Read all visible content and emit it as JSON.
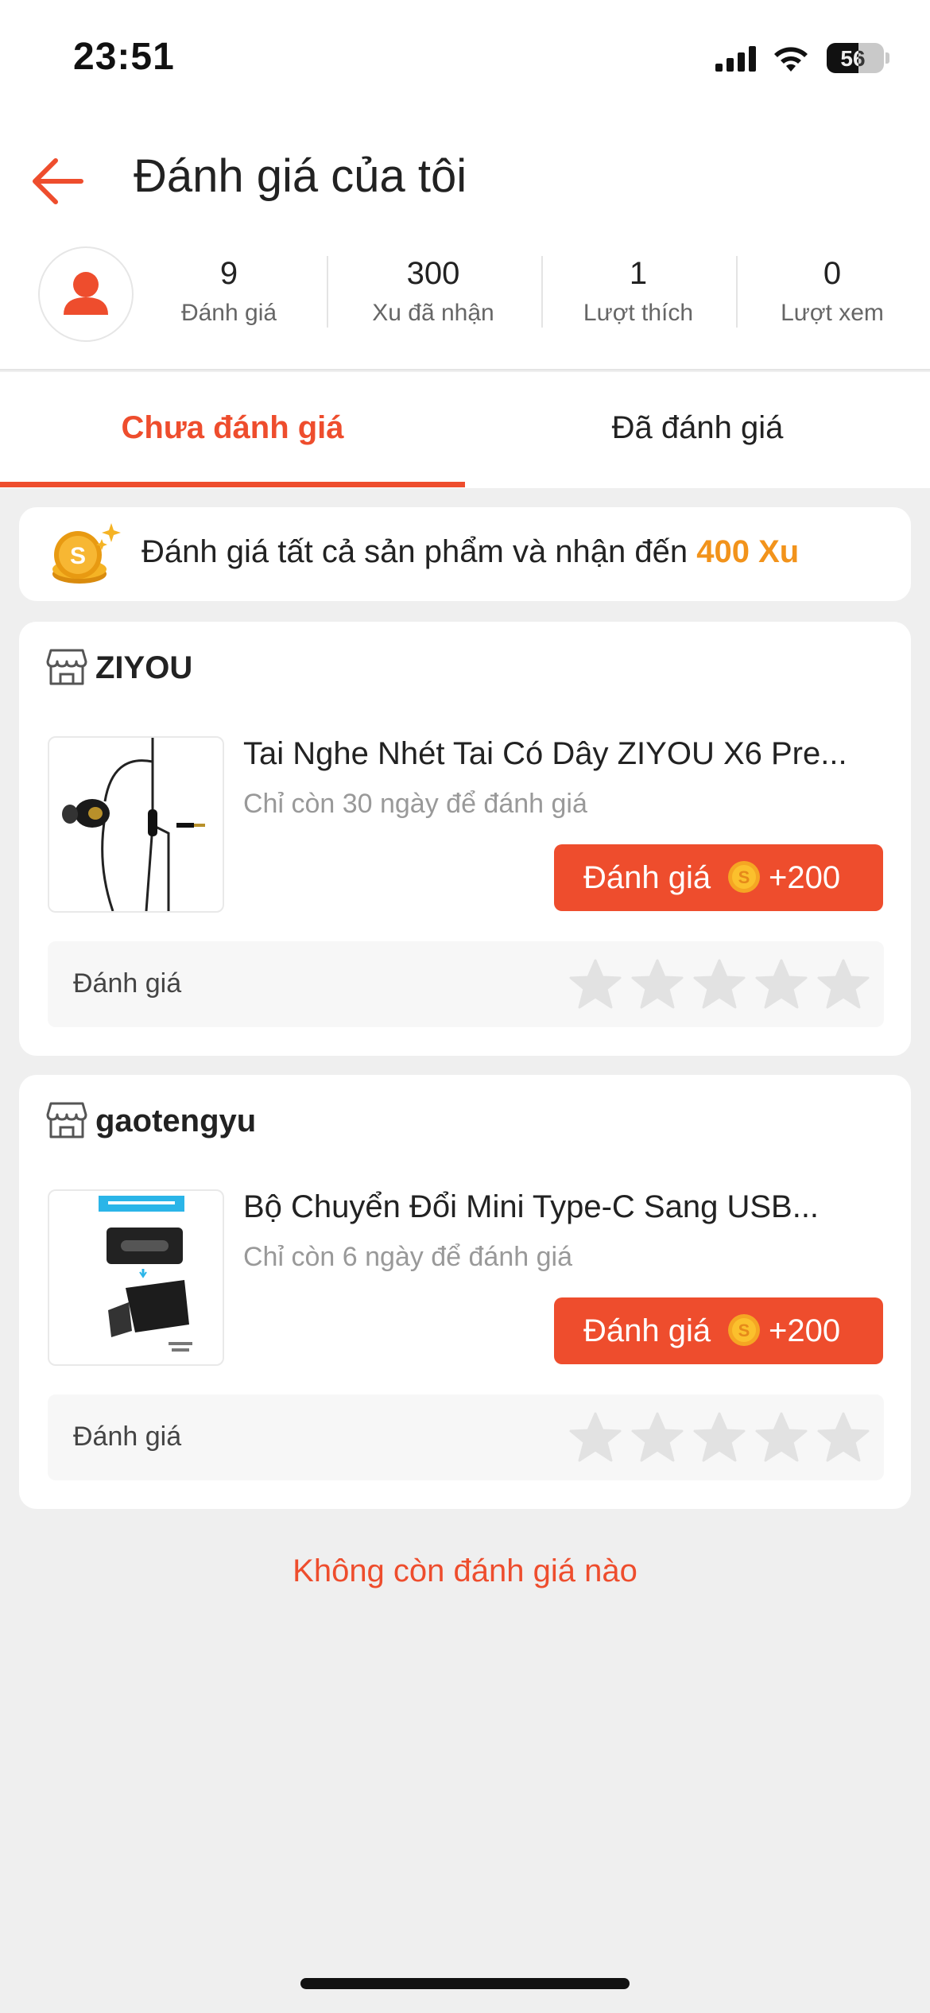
{
  "status_bar": {
    "time": "23:51",
    "battery_level": "56",
    "battery_fraction": 0.56
  },
  "header": {
    "back_icon": "arrow-left-icon",
    "title": "Đánh giá của tôi"
  },
  "stats": {
    "avatar_icon": "user-silhouette-icon",
    "items": [
      {
        "value": "9",
        "label": "Đánh giá"
      },
      {
        "value": "300",
        "label": "Xu đã nhận"
      },
      {
        "value": "1",
        "label": "Lượt thích"
      },
      {
        "value": "0",
        "label": "Lượt xem"
      }
    ]
  },
  "tabs": [
    {
      "label": "Chưa đánh giá",
      "active": true
    },
    {
      "label": "Đã đánh giá",
      "active": false
    }
  ],
  "banner": {
    "icon": "coin-stack-icon",
    "text": "Đánh giá tất cả sản phẩm và nhận đến ",
    "highlight": "400 Xu"
  },
  "orders": [
    {
      "shop_name": "ZIYOU",
      "product_name": "Tai Nghe Nhét Tai Có Dây ZIYOU X6 Pre...",
      "deadline": "Chỉ còn 30 ngày để đánh giá",
      "button_label": "Đánh giá",
      "button_bonus": "+200",
      "rating_label": "Đánh giá",
      "stars": 0
    },
    {
      "shop_name": "gaotengyu",
      "product_name": "Bộ Chuyển Đổi Mini Type-C Sang USB...",
      "deadline": "Chỉ còn 6 ngày để đánh giá",
      "button_label": "Đánh giá",
      "button_bonus": "+200",
      "rating_label": "Đánh giá",
      "stars": 0
    }
  ],
  "footer": {
    "end_text": "Không còn đánh giá nào"
  },
  "colors": {
    "accent": "#ee4d2d",
    "coin": "#f2931b",
    "star_empty": "#e2e2e2"
  }
}
